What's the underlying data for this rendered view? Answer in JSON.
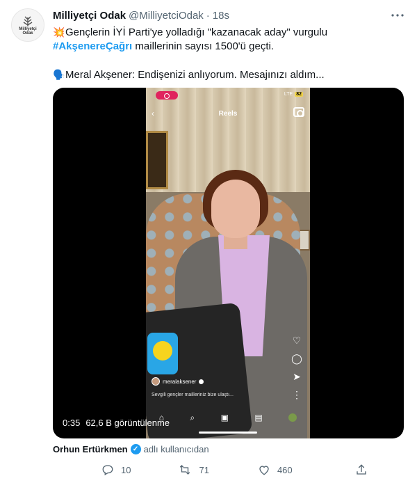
{
  "author": {
    "display_name": "Milliyetçi Odak",
    "handle": "@MilliyetciOdak",
    "separator": "·",
    "time": "18s",
    "avatar_text": "Milliyetçi\nOdak"
  },
  "tweet": {
    "emoji_1": "💥",
    "line_1": "Gençlerin İYİ Parti'ye yolladığı \"kazanacak aday\" vurgulu",
    "hashtag": "#AkşenereÇağrı",
    "line_2_rest": " maillerinin sayısı 1500'ü geçti.",
    "emoji_2": "🗣️",
    "line_3": "Meral Akşener: Endişenizi anlıyorum. Mesajınızı aldım..."
  },
  "video": {
    "duration": "0:35",
    "views": "62,6 B görüntülenme",
    "reels_header": "Reels",
    "network": "LTE",
    "battery": "82",
    "reels_username": "meralaksener",
    "caption": "Sevgili gençler mailleriniz bize ulaştı..."
  },
  "tagged": {
    "name": "Orhun Ertürkmen",
    "suffix": "adlı kullanıcıdan"
  },
  "actions": {
    "replies": "10",
    "retweets": "71",
    "likes": "460"
  },
  "colors": {
    "accent": "#1d9bf0",
    "secondary_text": "#536471",
    "primary_text": "#0f1419"
  },
  "icons": [
    "more-icon",
    "reply-icon",
    "retweet-icon",
    "like-icon",
    "share-icon",
    "verified-icon"
  ]
}
